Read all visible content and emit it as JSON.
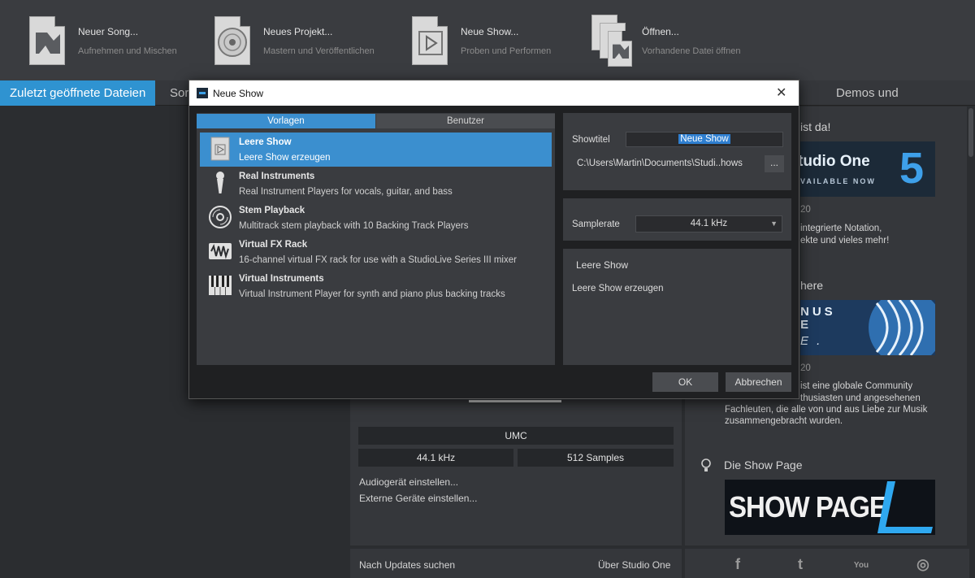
{
  "toolbar": {
    "items": [
      {
        "title": "Neuer Song...",
        "subtitle": "Aufnehmen und Mischen",
        "icon": "new-song-icon"
      },
      {
        "title": "Neues Projekt...",
        "subtitle": "Mastern und Veröffentlichen",
        "icon": "new-project-icon"
      },
      {
        "title": "Neue Show...",
        "subtitle": "Proben und Performen",
        "icon": "new-show-icon"
      },
      {
        "title": "Öffnen...",
        "subtitle": "Vorhandene Datei öffnen",
        "icon": "open-icon"
      }
    ]
  },
  "tabs": {
    "recent": "Zuletzt geöffnete Dateien",
    "partial": "Sor",
    "demos": "Demos und Anleitungen"
  },
  "audio": {
    "device": "UMC",
    "samplerate": "44.1 kHz",
    "buffer": "512 Samples",
    "setup_audio": "Audiogerät einstellen...",
    "setup_external": "Externe Geräte einstellen...",
    "check_updates": "Nach Updates suchen",
    "about": "Über Studio One"
  },
  "news": {
    "heading1": "ist da!",
    "banner1": "tudio One",
    "banner1_sub": "VAILABLE NOW",
    "banner1_num": "5",
    "date1": "20",
    "text1a": "integrierte Notation,",
    "text1b": "ekte und vieles mehr!",
    "heading2": "here",
    "banner2_l1": "NUS",
    "banner2_l2": "E",
    "banner2_l3": "E .",
    "date2": "20",
    "text2a": "ist eine globale Community",
    "text2b": "thusiasten und angesehenen",
    "text2c": "Fachleuten, die alle von und aus Liebe zur Musik",
    "text2d": "zusammengebracht wurden.",
    "heading3": "Die Show Page",
    "banner3": "SHOW PAGE"
  },
  "social": {
    "facebook": "f",
    "twitter": "t",
    "youtube": "You",
    "instagram": "◎"
  },
  "dialog": {
    "title": "Neue Show",
    "tab_templates": "Vorlagen",
    "tab_user": "Benutzer",
    "templates": [
      {
        "name": "Leere Show",
        "desc": "Leere Show erzeugen",
        "icon": "blank-show-icon",
        "selected": true
      },
      {
        "name": "Real Instruments",
        "desc": "Real Instrument Players for vocals, guitar, and bass",
        "icon": "microphone-icon"
      },
      {
        "name": "Stem Playback",
        "desc": "Multitrack stem playback with 10 Backing Track Players",
        "icon": "disc-icon"
      },
      {
        "name": "Virtual FX Rack",
        "desc": "16-channel virtual FX rack for use with a StudioLive Series III mixer",
        "icon": "fx-rack-icon"
      },
      {
        "name": "Virtual Instruments",
        "desc": "Virtual Instrument Player for synth and piano plus backing tracks",
        "icon": "piano-icon"
      }
    ],
    "showtitle_label": "Showtitel",
    "showtitle_value": "Neue Show",
    "path_value": "C:\\Users\\Martin\\Documents\\Studi..hows",
    "browse_label": "...",
    "samplerate_label": "Samplerate",
    "samplerate_value": "44.1 kHz",
    "info_title": "Leere Show",
    "info_desc": "Leere Show erzeugen",
    "ok_label": "OK",
    "cancel_label": "Abbrechen",
    "close_label": "✕"
  },
  "colors": {
    "accent": "#2f93d1",
    "selection": "#3b8fcf"
  }
}
